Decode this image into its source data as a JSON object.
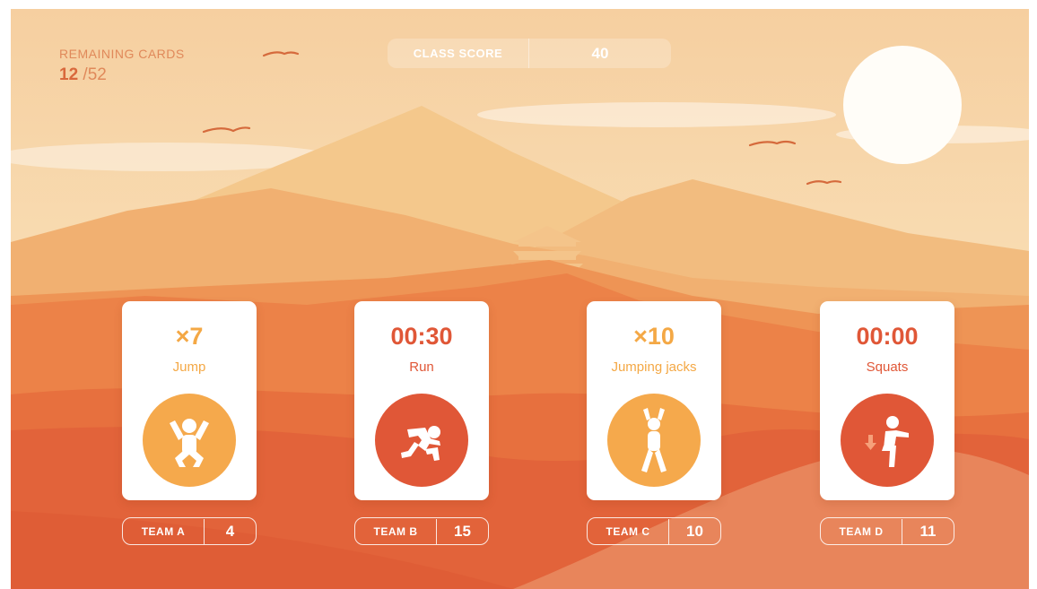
{
  "remaining": {
    "label": "REMAINING CARDS",
    "current": "12",
    "total": "/52"
  },
  "class_score": {
    "label": "CLASS SCORE",
    "value": "40"
  },
  "cards": [
    {
      "value": "×7",
      "exercise": "Jump",
      "color": "#f5a94c",
      "icon": "jump-icon"
    },
    {
      "value": "00:30",
      "exercise": "Run",
      "color": "#e05737",
      "icon": "run-icon"
    },
    {
      "value": "×10",
      "exercise": "Jumping jacks",
      "color": "#f5a94c",
      "icon": "jumping-jacks-icon"
    },
    {
      "value": "00:00",
      "exercise": "Squats",
      "color": "#e05737",
      "icon": "squats-icon"
    }
  ],
  "teams": [
    {
      "label": "TEAM A",
      "score": "4"
    },
    {
      "label": "TEAM B",
      "score": "15"
    },
    {
      "label": "TEAM C",
      "score": "10"
    },
    {
      "label": "TEAM D",
      "score": "11"
    }
  ]
}
